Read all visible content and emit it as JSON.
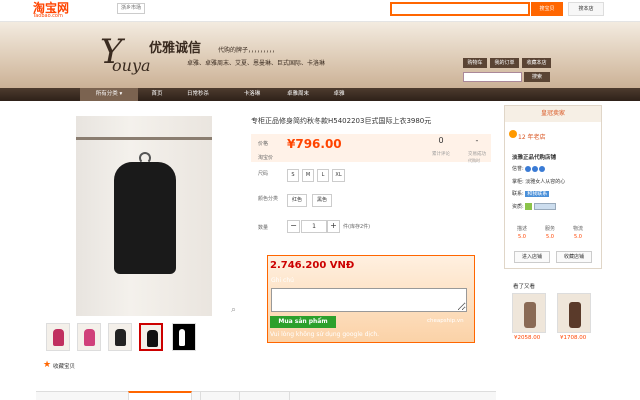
{
  "header": {
    "logo": "淘宝网",
    "logo_sub": "Taobao.com",
    "region": "浙乡市场",
    "search_button": "搜宝贝",
    "search_store_button": "搜本店"
  },
  "banner": {
    "brand_script": "Y",
    "brand_script2": "ouya",
    "brand_cn": "优雅诚信",
    "slogan": "代购的牌子，，，，，，，，，",
    "tags": "卓雅、卓雅周末、艾夏、恩曼琳、巨式国际、卡洛琳",
    "buttons": [
      "购物车",
      "我的订单",
      "收藏本店"
    ],
    "store_search_button": "搜索"
  },
  "nav": {
    "items": [
      "所有分类",
      "首页",
      "日常秒杀",
      "卡洛琳",
      "卓雅周末",
      "卓雅"
    ]
  },
  "product": {
    "title": "专柜正品修身简约秋冬款H5402203巨式国际上衣3980元",
    "price_label": "价格",
    "tao_label": "淘宝价",
    "price": "¥796.00",
    "review_count": "0",
    "review_label": "累计评论",
    "sales_count": "-",
    "sales_label": "交易成功",
    "sales_hint": "代购时",
    "size_label": "尺码",
    "sizes": [
      "S",
      "M",
      "L",
      "XL"
    ],
    "color_label": "颜色分类",
    "colors": [
      "红色",
      "黑色"
    ],
    "qty_label": "数量",
    "qty_minus": "−",
    "qty_value": "1",
    "qty_plus": "+",
    "stock": "件(库存2件)",
    "favorite": "收藏宝贝"
  },
  "cheapship": {
    "price_vnd": "2.746.200 VNĐ",
    "note_label": "Ghi chú",
    "note_value": "",
    "buy_button": "Mua sản phẩm",
    "brand": "cheapship.vn",
    "warning": "Vui lòng không sử dụng google dịch."
  },
  "seller": {
    "heading": "皇冠卖家",
    "years": "12 年老店",
    "name": "淡雅正品代购店铺",
    "credit_label": "信誉:",
    "owner_label": "掌柜:",
    "owner": "淡雅女人从容的心",
    "contact_label": "联系:",
    "contact_badge": "和我联系",
    "quals_label": "资质:",
    "scores": [
      {
        "label": "描述",
        "value": "5.0"
      },
      {
        "label": "服务",
        "value": "5.0"
      },
      {
        "label": "物流",
        "value": "5.0"
      }
    ],
    "enter_store": "进入店铺",
    "fav_store": "收藏店铺",
    "viewed_label": "看了又看",
    "viewed_prices": [
      "¥2058.00",
      "¥1708.00"
    ]
  },
  "colors": {
    "accent": "#ff4400",
    "banner_brown": "#3a2b20",
    "buy_green": "#2ca02c"
  }
}
